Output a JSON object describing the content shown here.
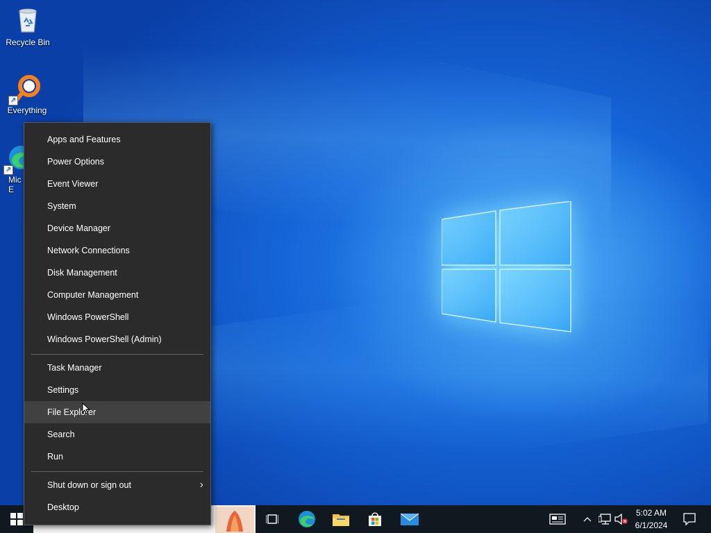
{
  "desktop": {
    "icons": [
      {
        "label": "Recycle Bin",
        "icon": "recycle-bin-icon"
      },
      {
        "label": "Everything",
        "icon": "everything-search-icon"
      },
      {
        "label": "Microsoft Edge",
        "icon": "edge-icon",
        "visible_label": "Mic E"
      }
    ]
  },
  "menu": {
    "group1": [
      "Apps and Features",
      "Power Options",
      "Event Viewer",
      "System",
      "Device Manager",
      "Network Connections",
      "Disk Management",
      "Computer Management",
      "Windows PowerShell",
      "Windows PowerShell (Admin)"
    ],
    "group2": [
      "Task Manager",
      "Settings",
      "File Explorer",
      "Search",
      "Run"
    ],
    "group3": [
      "Shut down or sign out",
      "Desktop"
    ],
    "hovered_item": "File Explorer",
    "submenu_chevron": "›"
  },
  "taskbar": {
    "pinned": [
      "task-view-icon",
      "edge-icon",
      "file-explorer-icon",
      "microsoft-store-icon",
      "mail-icon"
    ],
    "tray": [
      "news-and-interests-icon",
      "chevron-up-icon",
      "network-icon",
      "volume-muted-icon",
      "notification-icon"
    ],
    "time": "5:02 AM",
    "date": "6/1/2024"
  },
  "colors": {
    "menu_bg": "#2b2b2b",
    "menu_hover": "#414141",
    "taskbar_bg": "#101820",
    "accent": "#0078d4"
  }
}
